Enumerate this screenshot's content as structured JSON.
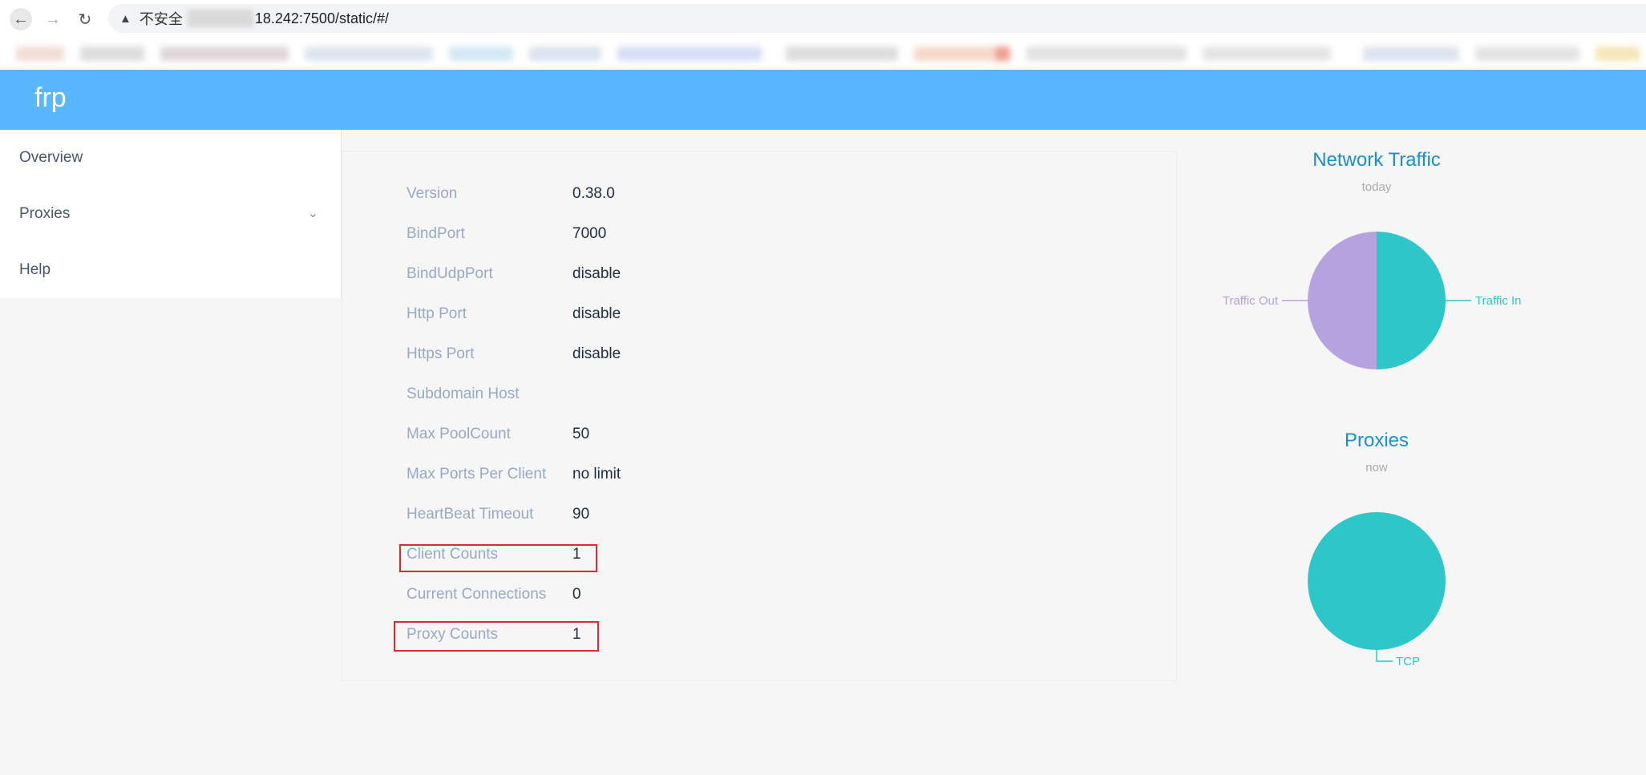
{
  "browser": {
    "security_label": "不安全",
    "url_visible": "18.242:7500/static/#/"
  },
  "app": {
    "brand": "frp",
    "header_color": "#58b7ff"
  },
  "sidebar": {
    "items": [
      {
        "label": "Overview"
      },
      {
        "label": "Proxies",
        "has_submenu": true
      },
      {
        "label": "Help"
      }
    ]
  },
  "server_info": {
    "rows": [
      {
        "label": "Version",
        "value": "0.38.0"
      },
      {
        "label": "BindPort",
        "value": "7000"
      },
      {
        "label": "BindUdpPort",
        "value": "disable"
      },
      {
        "label": "Http Port",
        "value": "disable"
      },
      {
        "label": "Https Port",
        "value": "disable"
      },
      {
        "label": "Subdomain Host",
        "value": ""
      },
      {
        "label": "Max PoolCount",
        "value": "50"
      },
      {
        "label": "Max Ports Per Client",
        "value": "no limit"
      },
      {
        "label": "HeartBeat Timeout",
        "value": "90"
      },
      {
        "label": "Client Counts",
        "value": "1"
      },
      {
        "label": "Current Connections",
        "value": "0"
      },
      {
        "label": "Proxy Counts",
        "value": "1"
      }
    ],
    "highlighted_rows": [
      "Client Counts",
      "Proxy Counts"
    ],
    "highlight_color": "#e0282d"
  },
  "chart_data": [
    {
      "type": "pie",
      "title": "Network Traffic",
      "subtitle": "today",
      "series": [
        {
          "name": "Traffic In",
          "value": 50,
          "color": "#2ec7c9"
        },
        {
          "name": "Traffic Out",
          "value": 50,
          "color": "#b6a2de"
        }
      ]
    },
    {
      "type": "pie",
      "title": "Proxies",
      "subtitle": "now",
      "series": [
        {
          "name": "TCP",
          "value": 1,
          "color": "#2ec7c9"
        }
      ]
    }
  ]
}
